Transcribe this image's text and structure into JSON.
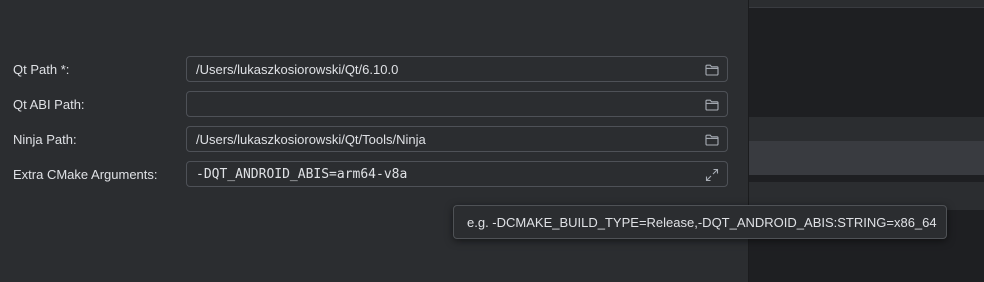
{
  "form": {
    "qt_path": {
      "label": "Qt Path *:",
      "value": "/Users/lukaszkosiorowski/Qt/6.10.0",
      "button_icon": "folder-icon"
    },
    "qt_abi_path": {
      "label": "Qt ABI Path:",
      "value": "",
      "button_icon": "folder-icon"
    },
    "ninja_path": {
      "label": "Ninja Path:",
      "value": "/Users/lukaszkosiorowski/Qt/Tools/Ninja",
      "button_icon": "folder-icon"
    },
    "extra_cmake": {
      "label": "Extra CMake Arguments:",
      "value": "-DQT_ANDROID_ABIS=arm64-v8a",
      "button_icon": "expand-icon"
    }
  },
  "tooltip": {
    "text": "e.g. -DCMAKE_BUILD_TYPE=Release,-DQT_ANDROID_ABIS:STRING=x86_64"
  },
  "colors": {
    "panel_bg": "#2b2d30",
    "window_bg": "#1e1f22",
    "field_border": "#4e5157",
    "text": "#dfe1e5",
    "icon": "#a8adb5"
  }
}
